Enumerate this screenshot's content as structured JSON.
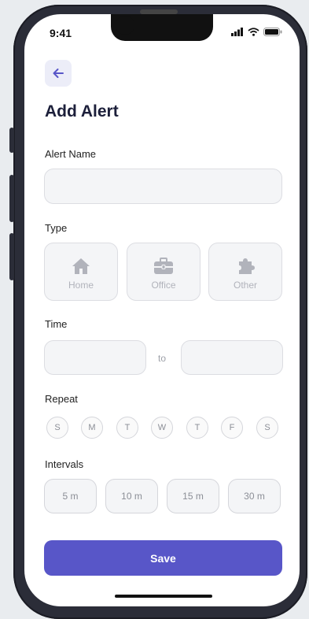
{
  "status": {
    "time": "9:41"
  },
  "header": {
    "title": "Add Alert",
    "back_icon": "arrow-left-icon"
  },
  "form": {
    "alert_name": {
      "label": "Alert Name",
      "value": ""
    },
    "type": {
      "label": "Type",
      "options": [
        {
          "label": "Home",
          "icon": "home-icon"
        },
        {
          "label": "Office",
          "icon": "briefcase-icon"
        },
        {
          "label": "Other",
          "icon": "puzzle-icon"
        }
      ]
    },
    "time": {
      "label": "Time",
      "separator": "to",
      "from_value": "",
      "to_value": ""
    },
    "repeat": {
      "label": "Repeat",
      "days": [
        "S",
        "M",
        "T",
        "W",
        "T",
        "F",
        "S"
      ]
    },
    "intervals": {
      "label": "Intervals",
      "options": [
        "5 m",
        "10 m",
        "15 m",
        "30 m"
      ]
    },
    "save_label": "Save"
  },
  "colors": {
    "accent": "#5856c8",
    "title": "#1c1f3a",
    "icon_gray": "#b1b3bb"
  }
}
